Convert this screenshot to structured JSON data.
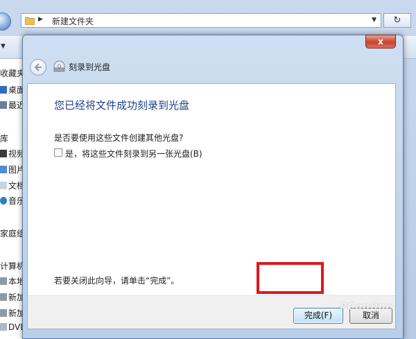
{
  "explorer": {
    "address": "新建文件夹",
    "sidebar": [
      {
        "label": "收藏夹",
        "icon": "star-icon"
      },
      {
        "label": "桌面",
        "icon": "desktop-icon"
      },
      {
        "label": "最近访问的位置",
        "icon": "recent-icon"
      },
      {
        "label": "库",
        "icon": "library-icon"
      },
      {
        "label": "视频",
        "icon": "video-icon"
      },
      {
        "label": "图片",
        "icon": "picture-icon"
      },
      {
        "label": "文档",
        "icon": "document-icon"
      },
      {
        "label": "音乐",
        "icon": "music-icon"
      },
      {
        "label": "家庭组",
        "icon": "homegroup-icon"
      },
      {
        "label": "计算机",
        "icon": "computer-icon"
      },
      {
        "label": "本地磁盘",
        "icon": "drive-icon"
      },
      {
        "label": "新加卷",
        "icon": "drive-icon"
      },
      {
        "label": "新加卷",
        "icon": "drive-icon"
      },
      {
        "label": "DVD",
        "icon": "dvd-icon"
      }
    ]
  },
  "dialog": {
    "close_label": "x",
    "title": "刻录到光盘",
    "heading": "您已经将文件成功刻录到光盘",
    "question": "是否要使用这些文件创建其他光盘?",
    "option_label": "是，将这些文件刻录到另一张光盘(B)",
    "option_checked": false,
    "hint": "若要关闭此向导，请单击“完成”。",
    "finish_label": "完成(F)",
    "cancel_label": "取消"
  },
  "watermark": "PConline",
  "colors": {
    "heading": "#1a3f8a",
    "highlight": "#e0161c",
    "close": "#c7432b"
  }
}
